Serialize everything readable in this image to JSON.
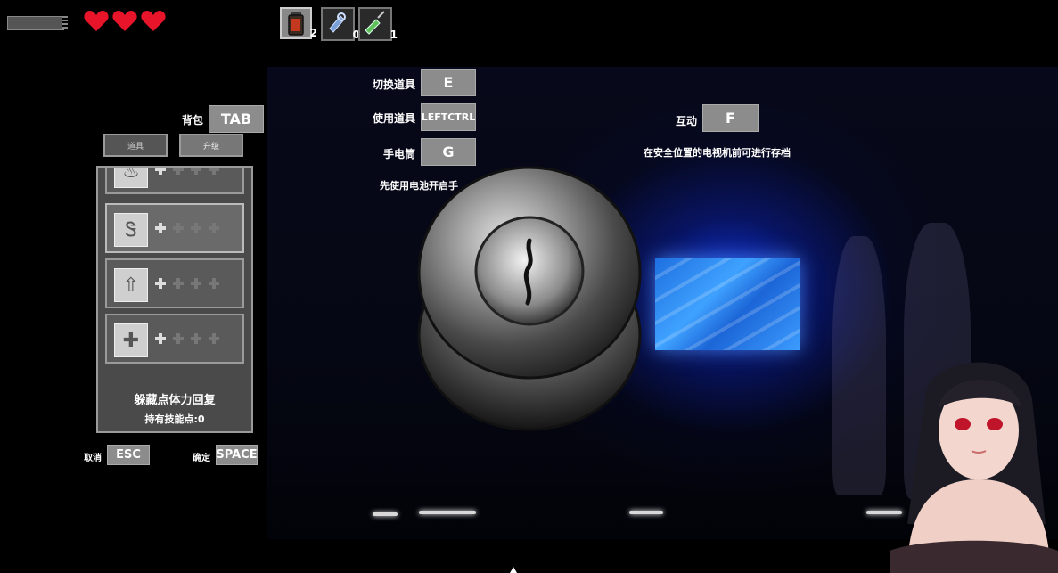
{
  "hud": {
    "hearts": 3,
    "heart_color": "#e8142a"
  },
  "inventory": [
    {
      "icon": "battery-icon",
      "count": "2",
      "active": true
    },
    {
      "icon": "key-icon",
      "count": "0",
      "active": false
    },
    {
      "icon": "syringe-icon",
      "count": "1",
      "active": false
    }
  ],
  "controls": {
    "switch_item": {
      "label": "切换道具",
      "key": "E"
    },
    "use_item": {
      "label": "使用道具",
      "key": "LEFTCTRL"
    },
    "flashlight": {
      "label": "手电筒",
      "key": "G"
    },
    "battery_hint": "先使用电池开启手",
    "interact": {
      "label": "互动",
      "key": "F"
    },
    "save_hint": "在安全位置的电视机前可进行存档"
  },
  "backpack": {
    "label": "背包",
    "key": "TAB",
    "tabs": [
      "道具",
      "升级"
    ]
  },
  "skills": {
    "items": [
      {
        "icon": "stamina-icon",
        "level": 1,
        "max": 4
      },
      {
        "icon": "stealth-icon",
        "level": 1,
        "max": 4
      },
      {
        "icon": "speed-icon",
        "level": 1,
        "max": 4
      },
      {
        "icon": "heal-icon",
        "level": 1,
        "max": 4
      }
    ],
    "selected_name": "躲藏点体力回复",
    "points_text": "持有技能点:0"
  },
  "footer": {
    "cancel_label": "取消",
    "cancel_key": "ESC",
    "confirm_label": "确定",
    "confirm_key": "SPACE"
  }
}
